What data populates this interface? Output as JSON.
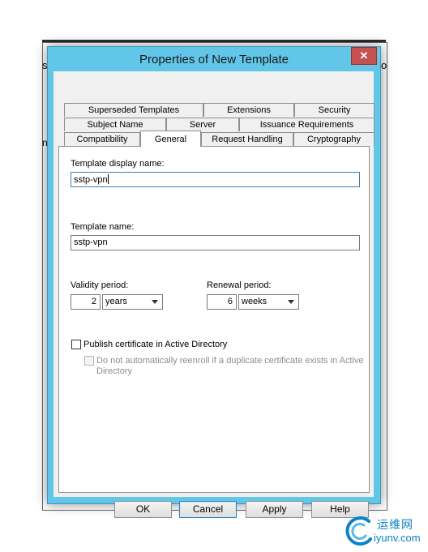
{
  "dialog": {
    "title": "Properties of New Template",
    "close_glyph": "✕"
  },
  "tabs": {
    "row1": [
      "Superseded Templates",
      "Extensions",
      "Security"
    ],
    "row2": [
      "Subject Name",
      "Server",
      "Issuance Requirements"
    ],
    "row3": [
      "Compatibility",
      "General",
      "Request Handling",
      "Cryptography"
    ],
    "active": "General"
  },
  "general": {
    "display_name_label": "Template display name:",
    "display_name_value": "sstp-vpn",
    "template_name_label": "Template name:",
    "template_name_value": "sstp-vpn",
    "validity_label": "Validity period:",
    "validity_value": "2",
    "validity_unit": "years",
    "renewal_label": "Renewal period:",
    "renewal_value": "6",
    "renewal_unit": "weeks",
    "publish_label": "Publish certificate in Active Directory",
    "publish_checked": false,
    "reenroll_line1": "Do not automatically reenroll if a duplicate certificate exists in Active",
    "reenroll_line2": "Directory",
    "reenroll_checked": false,
    "reenroll_enabled": false
  },
  "buttons": {
    "ok": "OK",
    "cancel": "Cancel",
    "apply": "Apply",
    "help": "Help"
  },
  "background_fragments": [
    "s",
    "o",
    "n"
  ],
  "watermark": {
    "brand_cn": "运维网",
    "url": "iyunv.com"
  },
  "colors": {
    "title_bar": "#62c6e8",
    "close_button": "#c75050",
    "watermark": "#0e82c6"
  }
}
